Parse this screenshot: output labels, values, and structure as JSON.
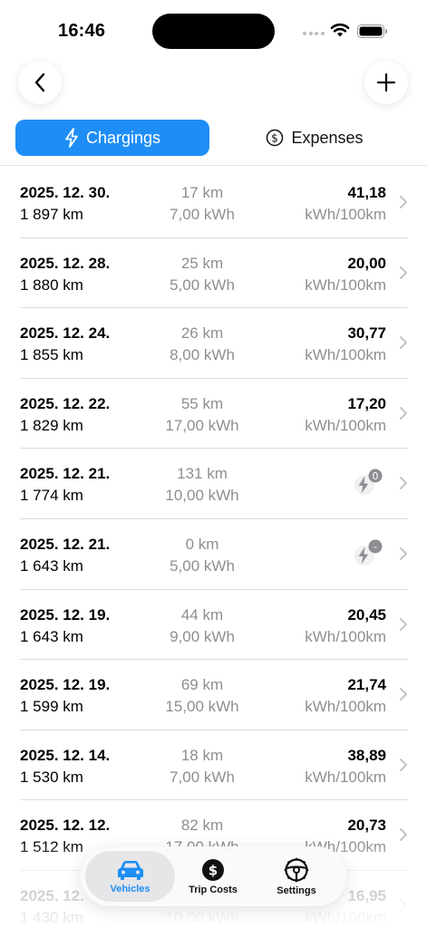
{
  "status": {
    "time": "16:46"
  },
  "segments": {
    "chargings": "Chargings",
    "expenses": "Expenses"
  },
  "rows": [
    {
      "date": "2025. 12. 30.",
      "odometer": "1 897 km",
      "distance": "17 km",
      "energy": "7,00 kWh",
      "consumption": "41,18",
      "unit": "kWh/100km"
    },
    {
      "date": "2025. 12. 28.",
      "odometer": "1 880 km",
      "distance": "25 km",
      "energy": "5,00 kWh",
      "consumption": "20,00",
      "unit": "kWh/100km"
    },
    {
      "date": "2025. 12. 24.",
      "odometer": "1 855 km",
      "distance": "26 km",
      "energy": "8,00 kWh",
      "consumption": "30,77",
      "unit": "kWh/100km"
    },
    {
      "date": "2025. 12. 22.",
      "odometer": "1 829 km",
      "distance": "55 km",
      "energy": "17,00 kWh",
      "consumption": "17,20",
      "unit": "kWh/100km"
    },
    {
      "date": "2025. 12. 21.",
      "odometer": "1 774 km",
      "distance": "131 km",
      "energy": "10,00 kWh",
      "badge": "0"
    },
    {
      "date": "2025. 12. 21.",
      "odometer": "1 643 km",
      "distance": "0 km",
      "energy": "5,00 kWh",
      "badge": "-"
    },
    {
      "date": "2025. 12. 19.",
      "odometer": "1 643 km",
      "distance": "44 km",
      "energy": "9,00 kWh",
      "consumption": "20,45",
      "unit": "kWh/100km"
    },
    {
      "date": "2025. 12. 19.",
      "odometer": "1 599 km",
      "distance": "69 km",
      "energy": "15,00 kWh",
      "consumption": "21,74",
      "unit": "kWh/100km"
    },
    {
      "date": "2025. 12. 14.",
      "odometer": "1 530 km",
      "distance": "18 km",
      "energy": "7,00 kWh",
      "consumption": "38,89",
      "unit": "kWh/100km"
    },
    {
      "date": "2025. 12. 12.",
      "odometer": "1 512 km",
      "distance": "82 km",
      "energy": "17,00 kWh",
      "consumption": "20,73",
      "unit": "kWh/100km"
    },
    {
      "date": "2025. 12.",
      "odometer": "1 430 km",
      "distance": "",
      "energy": "10,00 kWh",
      "consumption": "16,95",
      "unit": "kWh/100km"
    }
  ],
  "tabs": {
    "vehicles": "Vehicles",
    "trip_costs": "Trip Costs",
    "settings": "Settings"
  },
  "colors": {
    "accent": "#1e8ef6"
  }
}
